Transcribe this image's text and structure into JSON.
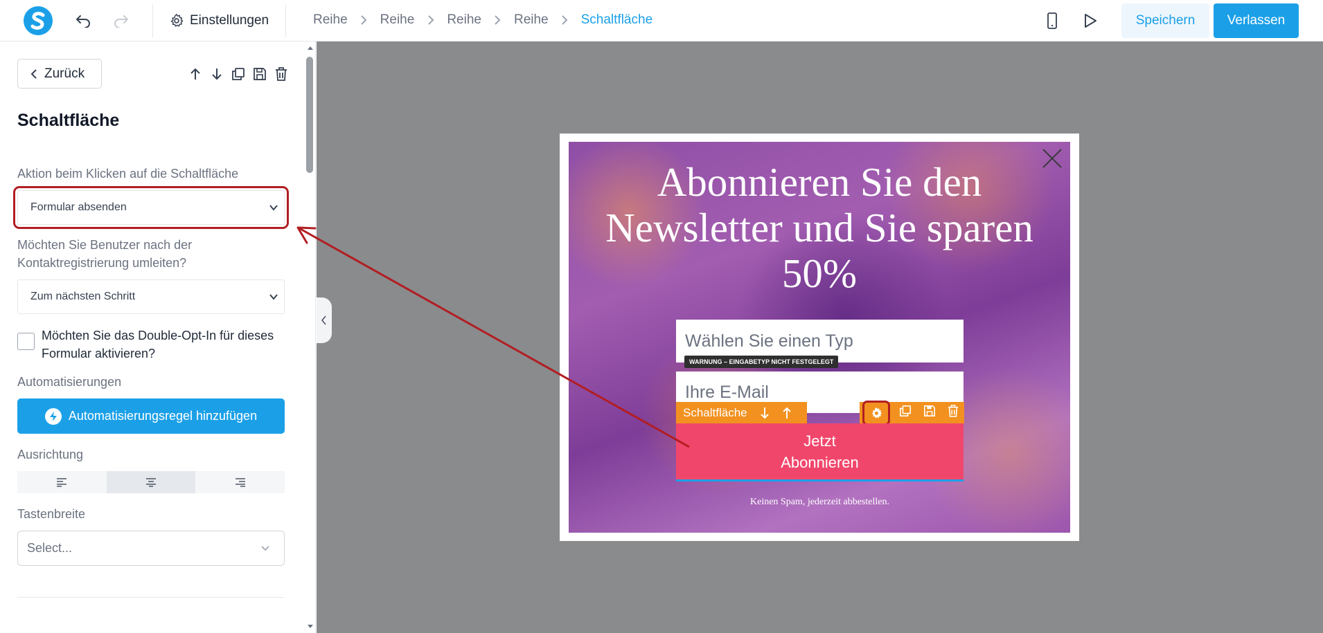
{
  "topbar": {
    "settings_label": "Einstellungen",
    "breadcrumbs": [
      "Reihe",
      "Reihe",
      "Reihe",
      "Reihe",
      "Schaltfläche"
    ],
    "save_label": "Speichern",
    "exit_label": "Verlassen"
  },
  "sidebar": {
    "back_label": "Zurück",
    "title": "Schaltfläche",
    "action_label": "Aktion beim Klicken auf die Schaltfläche",
    "action_value": "Formular absenden",
    "redirect_label": "Möchten Sie Benutzer nach der Kontaktregistrierung umleiten?",
    "redirect_value": "Zum nächsten Schritt",
    "double_opt_in_label": "Möchten Sie das Double-Opt-In für dieses Formular aktivieren?",
    "automations_label": "Automatisierungen",
    "add_automation_label": "Automatisierungsregel hinzufügen",
    "alignment_label": "Ausrichtung",
    "alignment_selected": "center",
    "button_width_label": "Tastenbreite",
    "button_width_placeholder": "Select..."
  },
  "popup": {
    "headline": "Abonnieren Sie den Newsletter und Sie sparen 50%",
    "type_placeholder": "Wählen Sie einen Typ",
    "warning_badge": "WARNUNG – EINGABETYP NICHT FESTGELEGT",
    "email_placeholder": "Ihre E-Mail",
    "element_label": "Schaltfläche",
    "subscribe_line1": "Jetzt",
    "subscribe_line2": "Abonnieren",
    "footer_text": "Keinen Spam, jederzeit abbestellen."
  },
  "colors": {
    "accent": "#1ba0e8",
    "subscribe_button": "#f1466b",
    "element_toolbar": "#f2911f",
    "annotation_red": "#b11e23"
  }
}
